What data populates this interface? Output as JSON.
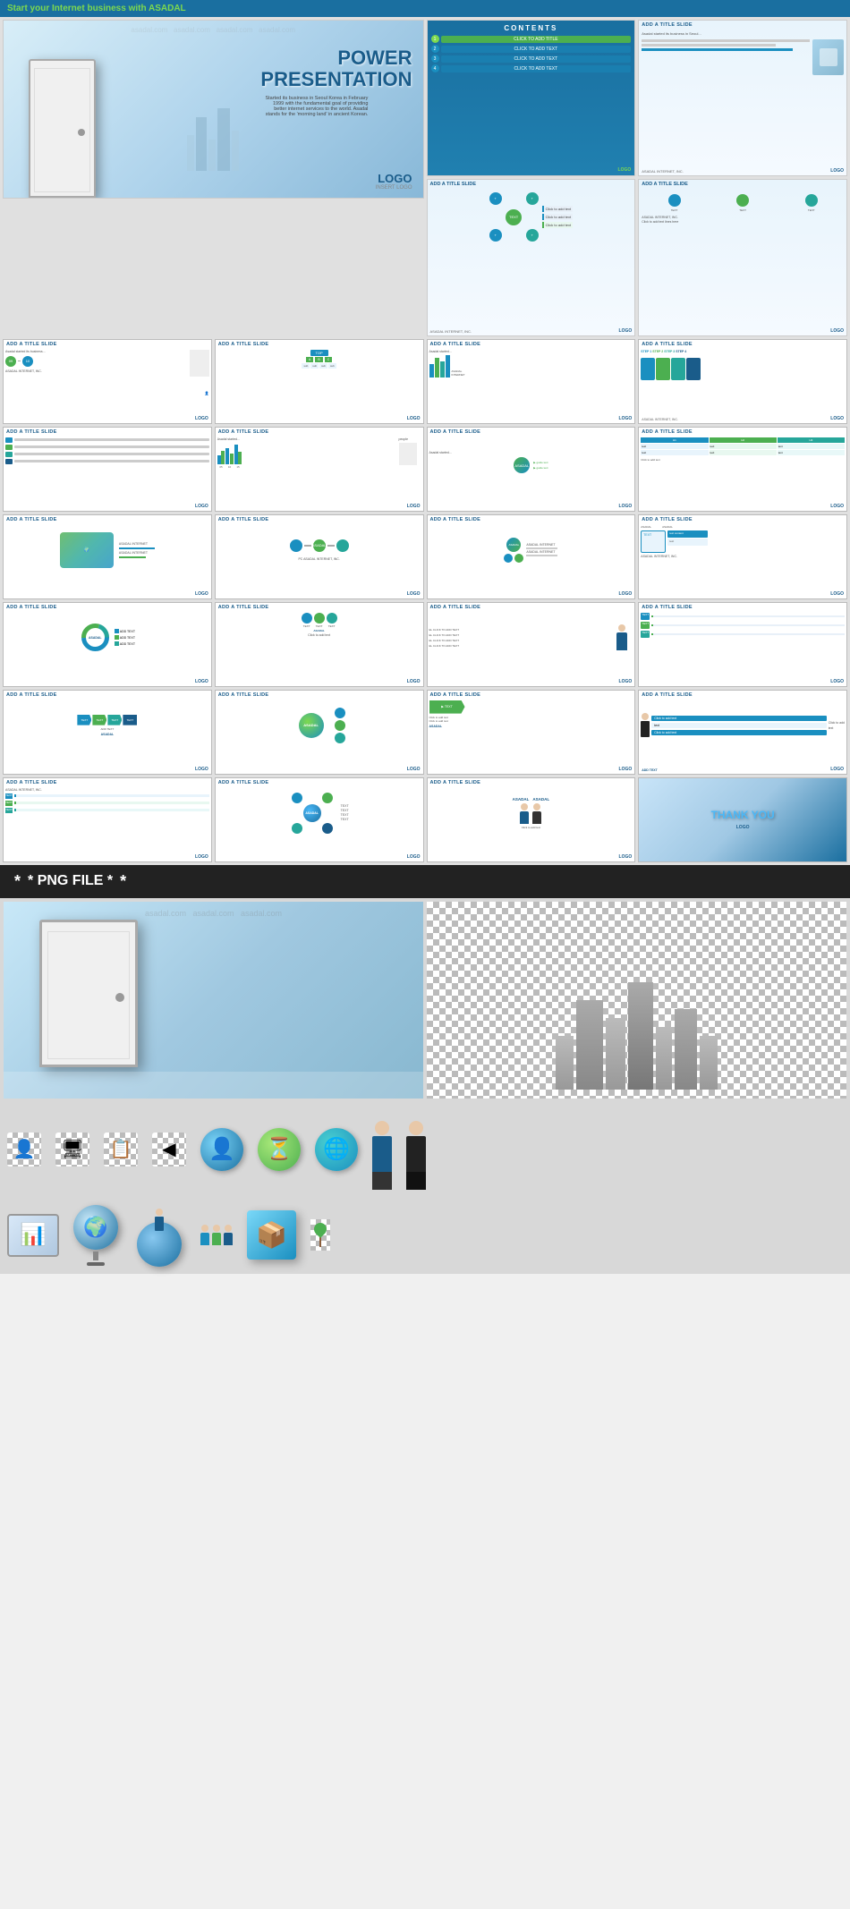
{
  "topBanner": {
    "text": "Start your Internet business with ",
    "brand": "ASADAL"
  },
  "hero": {
    "title": "POWER\nPRESENTATION",
    "subtitle": "Started its business in Seoul Korea in February 1999 with the fundamental goal of providing better internet services to the world. Asadal stands for the 'morning land' in ancient Korean.",
    "logoText": "LOGO",
    "logoSub": "INSERT LOGO"
  },
  "contentsSlide": {
    "title": "CONTENTS",
    "items": [
      {
        "num": "1",
        "text": "CLICK TO ADD TITLE",
        "color": "green"
      },
      {
        "num": "2",
        "text": "CLICK TO ADD TEXT",
        "color": "blue"
      },
      {
        "num": "3",
        "text": "CLICK TO ADD TEXT",
        "color": "blue"
      },
      {
        "num": "4",
        "text": "CLICK TO ADD TEXT",
        "color": "blue"
      }
    ]
  },
  "slideTitle": "ADD A TITLE SLIDE",
  "slides": {
    "row1": [
      "ADD A TITLE SLIDE",
      "ADD A TITLE SLIDE",
      "ADD A TITLE SLIDE",
      "ADD A TITLE SLIDE"
    ],
    "row2": [
      "ADD A TITLE SLIDE",
      "ADD A TITLE SLIDE",
      "ADD A TITLE SLIDE",
      "ADD A TITLE SLIDE"
    ],
    "row3": [
      "ADD A TITLE SLIDE",
      "ADD A TITLE SLIDE",
      "ADD A TITLE SLIDE",
      "ADD A TITLE SLIDE"
    ],
    "row4": [
      "ADD A TITLE SLIDE",
      "ADD A TITLE SLIDE",
      "ADD A TITLE SLIDE",
      "ADD A TITLE SLIDE"
    ],
    "row5": [
      "ADD A TITLE SLIDE",
      "ADD A TITLE SLIDE",
      "ADD A TITLE SLIDE",
      "ADD A TITLE SLIDE"
    ],
    "row6": [
      "ADD A TITLE SLIDE",
      "ADD A TITLE SLIDE",
      "ADD A TITLE SLIDE"
    ],
    "thankyou": "THANK YOU"
  },
  "pngSection": {
    "label": "* PNG FILE *"
  },
  "icons": {
    "circles": [
      "👤",
      "⏳",
      "🌐"
    ],
    "squares": [
      "👤",
      "🖥",
      "📋",
      "◀"
    ],
    "globes": [
      "🌐",
      "🌍"
    ],
    "chart": "📊"
  },
  "asadal": "ASADAL",
  "logo": "LOGO"
}
